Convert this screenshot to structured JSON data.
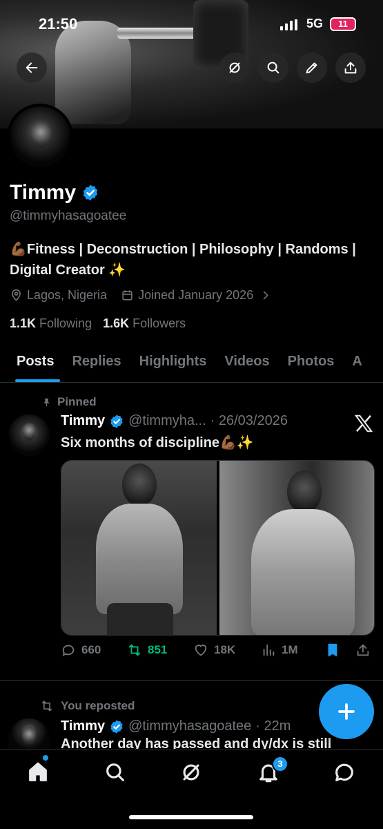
{
  "status_bar": {
    "time": "21:50",
    "network": "5G",
    "battery": "11"
  },
  "profile": {
    "display_name": "Timmy",
    "handle": "@timmyhasagoatee",
    "bio": "💪🏾Fitness | Deconstruction | Philosophy | Randoms | Digital Creator ✨",
    "location": "Lagos, Nigeria",
    "joined": "Joined January 2026",
    "following_count": "1.1K",
    "following_label": "Following",
    "followers_count": "1.6K",
    "followers_label": "Followers"
  },
  "tabs": [
    {
      "label": "Posts"
    },
    {
      "label": "Replies"
    },
    {
      "label": "Highlights"
    },
    {
      "label": "Videos"
    },
    {
      "label": "Photos"
    },
    {
      "label": "A"
    }
  ],
  "pinned_post": {
    "pinned_label": "Pinned",
    "author": "Timmy",
    "handle": "@timmyha...",
    "date": "· 26/03/2026",
    "text": "Six months of discipline💪🏾✨",
    "replies": "660",
    "reposts": "851",
    "likes": "18K",
    "views": "1M"
  },
  "repost": {
    "label": "You reposted",
    "author": "Timmy",
    "handle": "@timmyhasagoatee",
    "time": "· 22m",
    "text": "Another day has passed and dy/dx is still"
  },
  "nav": {
    "notifications_badge": "3"
  },
  "colors": {
    "accent": "#1d9bf0",
    "repost_green": "#00ba7c",
    "muted": "#71767b",
    "background": "#000000"
  }
}
